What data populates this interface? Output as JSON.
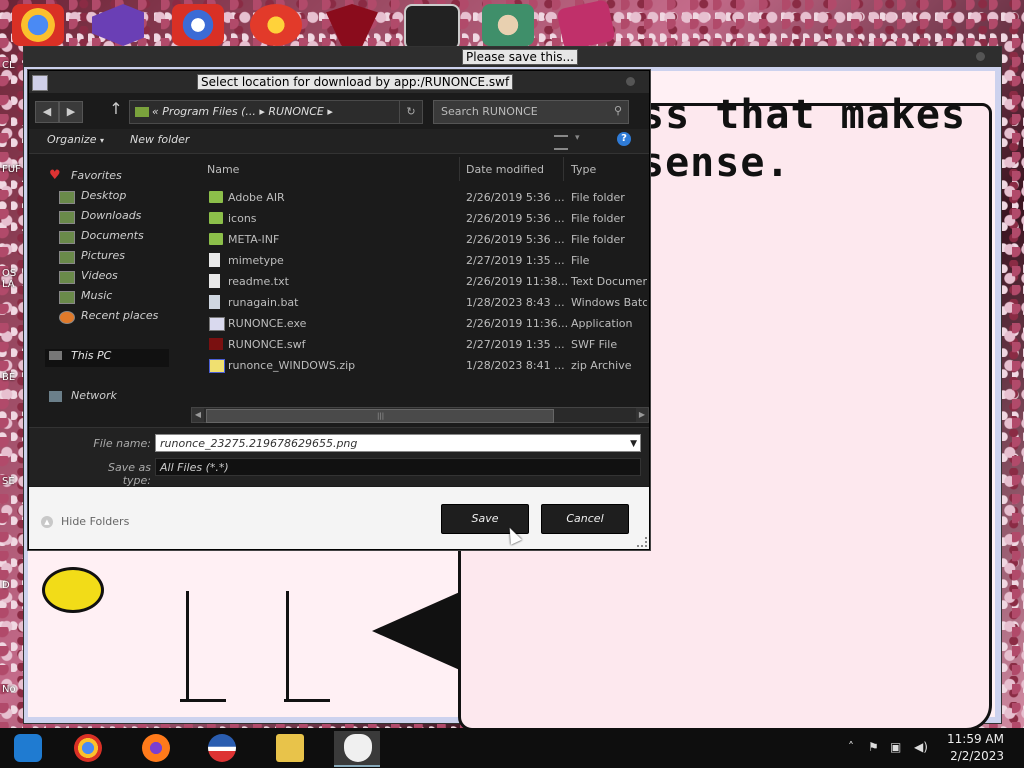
{
  "desktop": {
    "icons": [
      {
        "name": "chrome-shortcut",
        "color": "#d93025"
      },
      {
        "name": "visual-studio-shortcut",
        "color": "#6a3fb5"
      },
      {
        "name": "app-2-shortcut",
        "color": "#3b6bd6"
      },
      {
        "name": "p-app-shortcut",
        "color": "#e23a2a"
      },
      {
        "name": "red-app-shortcut",
        "color": "#8a0c1c"
      },
      {
        "name": "cmd-shortcut",
        "color": "#222222"
      },
      {
        "name": "game-shortcut",
        "color": "#3f8f6a"
      },
      {
        "name": "pink-app-shortcut",
        "color": "#c0306a"
      }
    ],
    "labels": [
      "CL",
      "FUF",
      "OS LA",
      "BE",
      "SE",
      "D",
      "No"
    ]
  },
  "app_window": {
    "title": "Please save this...",
    "bubble_text": "ss that makes sense."
  },
  "dialog": {
    "title": "Select location for download by app:/RUNONCE.swf",
    "address": {
      "prefix": "«",
      "part1": "Program Files (...",
      "sep": "▸",
      "part2": "RUNONCE"
    },
    "search_placeholder": "Search RUNONCE",
    "toolbar": {
      "organize": "Organize",
      "new_folder": "New folder",
      "help": "?"
    },
    "sidebar": {
      "favorites_label": "Favorites",
      "favorites": [
        "Desktop",
        "Downloads",
        "Documents",
        "Pictures",
        "Videos",
        "Music",
        "Recent places"
      ],
      "this_pc": "This PC",
      "network": "Network"
    },
    "columns": {
      "name": "Name",
      "date": "Date modified",
      "type": "Type"
    },
    "files": [
      {
        "name": "Adobe AIR",
        "date": "2/26/2019 5:36 ...",
        "type": "File folder",
        "icon": "folder-icon"
      },
      {
        "name": "icons",
        "date": "2/26/2019 5:36 ...",
        "type": "File folder",
        "icon": "folder-icon"
      },
      {
        "name": "META-INF",
        "date": "2/26/2019 5:36 ...",
        "type": "File folder",
        "icon": "folder-icon"
      },
      {
        "name": "mimetype",
        "date": "2/27/2019 1:35 ...",
        "type": "File",
        "icon": "file-icon"
      },
      {
        "name": "readme.txt",
        "date": "2/26/2019 11:38...",
        "type": "Text Documen",
        "icon": "text-file-icon"
      },
      {
        "name": "runagain.bat",
        "date": "1/28/2023 8:43 ...",
        "type": "Windows Batc",
        "icon": "batch-file-icon"
      },
      {
        "name": "RUNONCE.exe",
        "date": "2/26/2019 11:36...",
        "type": "Application",
        "icon": "exe-icon"
      },
      {
        "name": "RUNONCE.swf",
        "date": "2/27/2019 1:35 ...",
        "type": "SWF File",
        "icon": "flash-icon"
      },
      {
        "name": "runonce_WINDOWS.zip",
        "date": "1/28/2023 8:41 ...",
        "type": "zip Archive",
        "icon": "zip-icon"
      }
    ],
    "form": {
      "file_name_label": "File name:",
      "file_name_value": "runonce_23275.219678629655.png",
      "save_type_label": "Save as type:",
      "save_type_value": "All Files (*.*)"
    },
    "footer": {
      "hide_folders": "Hide Folders",
      "save": "Save",
      "cancel": "Cancel"
    }
  },
  "taskbar": {
    "apps": [
      {
        "name": "file-explorer-app",
        "color": "#1f7bd1"
      },
      {
        "name": "chrome-app",
        "color": "#d93025"
      },
      {
        "name": "firefox-app",
        "color": "#ff7a1a"
      },
      {
        "name": "obama-logo-app",
        "color": "#2a5db0"
      },
      {
        "name": "folder-app",
        "color": "#e8c34a"
      },
      {
        "name": "bunny-app",
        "color": "#f0f0f0"
      }
    ],
    "time": "11:59 AM",
    "date": "2/2/2023"
  }
}
